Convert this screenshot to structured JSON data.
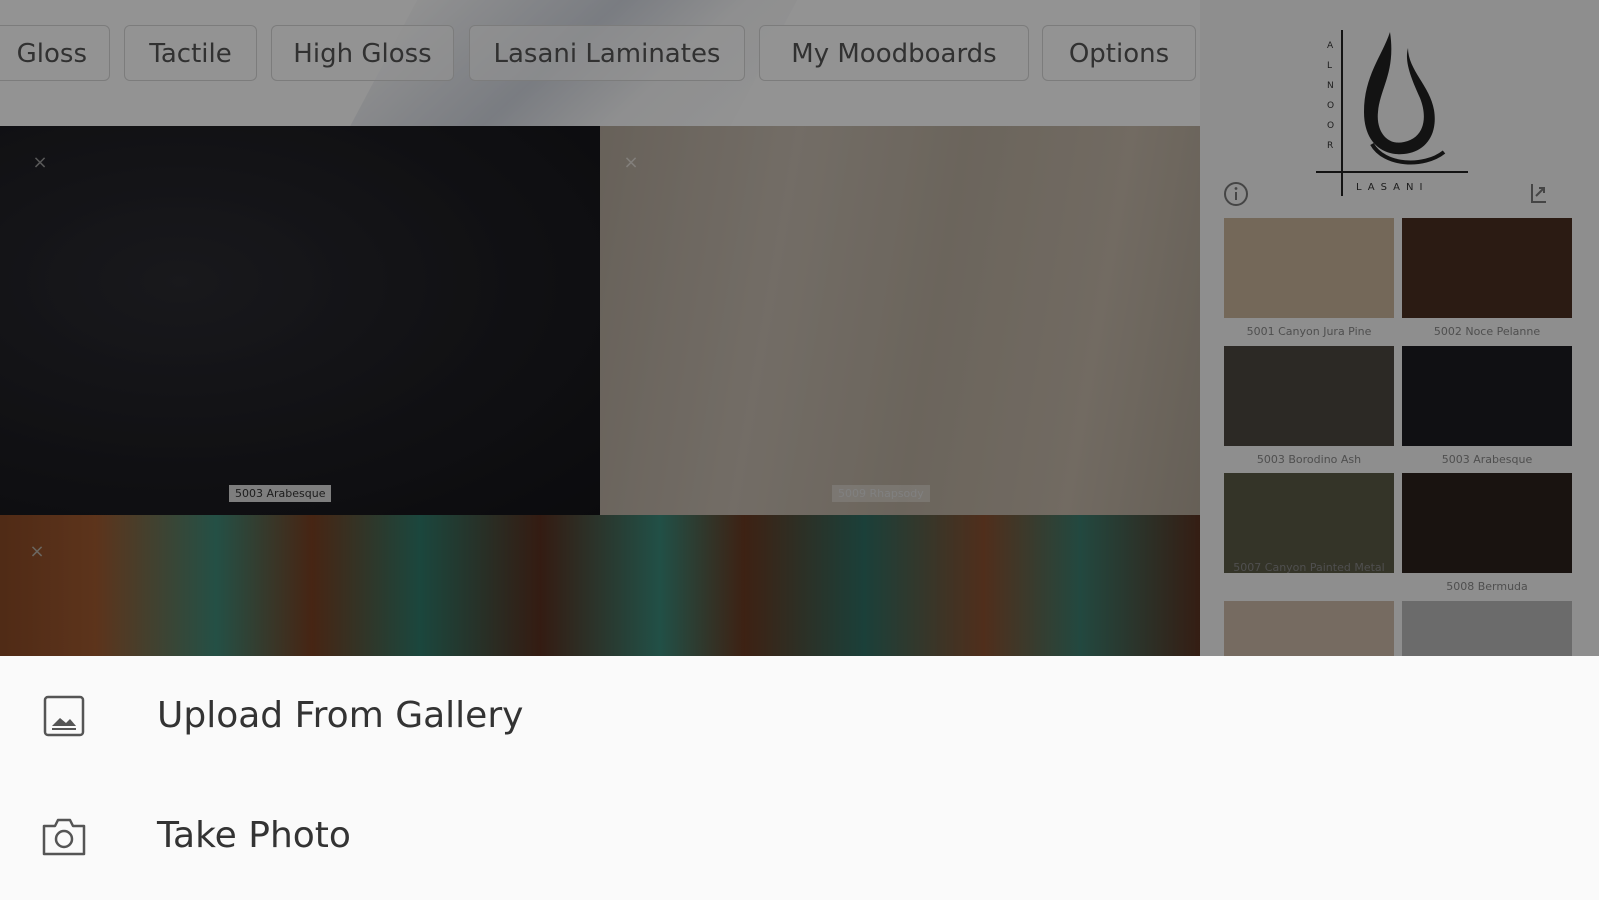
{
  "tabs": [
    "Gloss",
    "Tactile",
    "High Gloss",
    "Lasani Laminates",
    "My Moodboards",
    "Options"
  ],
  "brand": {
    "vertical_text": "ALNOOR",
    "wordmark": "LASANI"
  },
  "board": {
    "tiles": [
      {
        "caption": "5003 Arabesque",
        "close": "×"
      },
      {
        "caption": "5009 Rhapsody",
        "close": "×"
      },
      {
        "caption": "",
        "close": "×"
      }
    ]
  },
  "swatches": [
    {
      "label": "5001 Canyon Jura Pine",
      "color": "#c9b49a"
    },
    {
      "label": "5002 Noce Pelanne",
      "color": "#4a2f22"
    },
    {
      "label": "5003 Borodino Ash",
      "color": "#4c4740"
    },
    {
      "label": "5003 Arabesque",
      "color": "#1d1d22"
    },
    {
      "label": "5007 Canyon Painted Metal",
      "color": "#5b5a45"
    },
    {
      "label": "5008 Bermuda",
      "color": "#2c211c"
    },
    {
      "label": "",
      "color": "#cbb9a7"
    },
    {
      "label": "",
      "color": "#b8b8b8"
    }
  ],
  "sheet": {
    "upload_label": "Upload From Gallery",
    "photo_label": "Take Photo"
  }
}
